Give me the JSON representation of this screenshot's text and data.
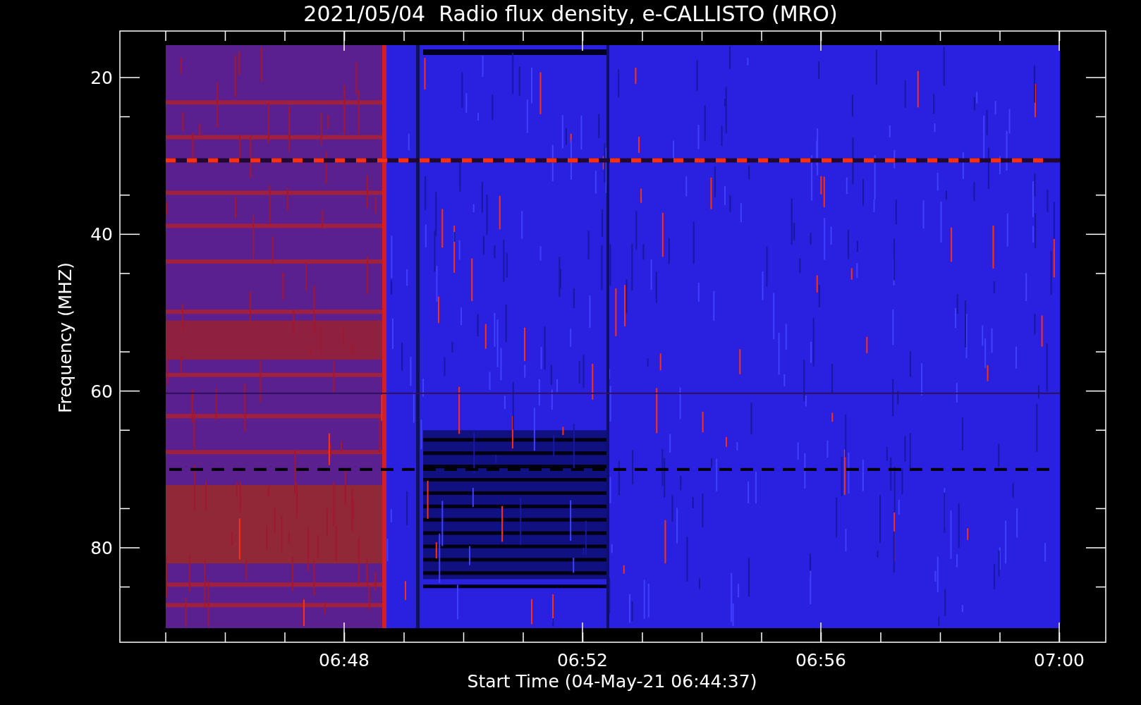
{
  "title": "2021/05/04  Radio flux density, e-CALLISTO (MRO)",
  "y_axis": {
    "label": "Frequency (MHZ)",
    "ticks": [
      "20",
      "40",
      "60",
      "80"
    ]
  },
  "x_axis": {
    "label": "Start Time (04-May-21 06:44:37)",
    "ticks": [
      "06:48",
      "06:52",
      "06:56",
      "07:00"
    ]
  }
}
